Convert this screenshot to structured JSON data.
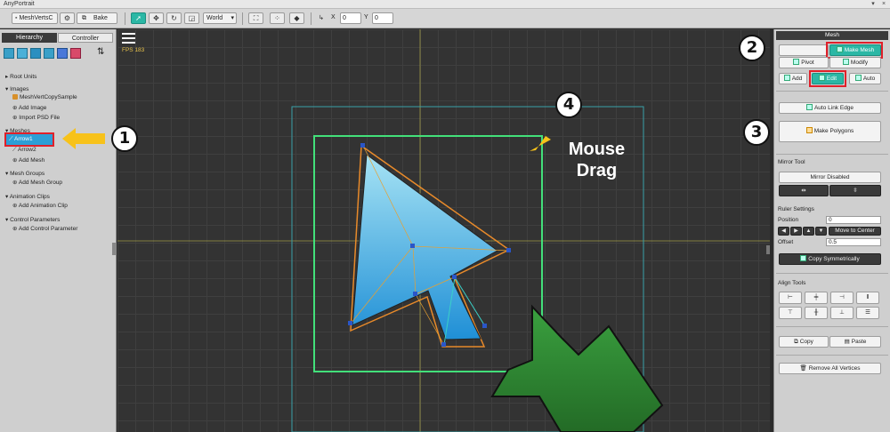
{
  "window": {
    "title": "AnyPortrait",
    "controls": [
      "▾",
      "×"
    ]
  },
  "toolbar": {
    "mesh_select": "MeshVertsC",
    "bake_label": "Bake",
    "space_select": "World",
    "x_label": "X",
    "x_value": "0",
    "y_label": "Y",
    "y_value": "0"
  },
  "left_panel": {
    "tab_hierarchy": "Hierarchy",
    "tab_controller": "Controller",
    "root_units": "Root Units",
    "images": "Images",
    "image_item": "MeshVertCopySample",
    "add_image": "Add Image",
    "import_psd": "Import PSD File",
    "meshes": "Meshes",
    "mesh_item_1": "Arrow1",
    "mesh_item_2": "Arrow2",
    "add_mesh": "Add Mesh",
    "mesh_groups": "Mesh Groups",
    "add_mesh_group": "Add Mesh Group",
    "animation_clips": "Animation Clips",
    "add_animation_clip": "Add Animation Clip",
    "control_parameters": "Control Parameters",
    "add_control_parameter": "Add Control Parameter"
  },
  "canvas": {
    "fps": "FPS 183",
    "annotation_line1": "Mouse",
    "annotation_line2": "Drag"
  },
  "right_panel": {
    "header": "Mesh",
    "make_mesh": "Make Mesh",
    "pivot": "Pivot",
    "modify": "Modify",
    "add": "Add",
    "edit": "Edit",
    "auto": "Auto",
    "auto_link_edge": "Auto Link Edge",
    "make_polygons": "Make Polygons",
    "mirror_tool": "Mirror Tool",
    "mirror_disabled": "Mirror Disabled",
    "ruler_settings": "Ruler Settings",
    "position_label": "Position",
    "position_value": "0",
    "move_to_center": "Move to Center",
    "offset_label": "Offset",
    "offset_value": "0.5",
    "copy_symmetrically": "Copy Symmetrically",
    "align_tools": "Align Tools",
    "copy": "Copy",
    "paste": "Paste",
    "remove_all_vertices": "Remove All Vertices"
  },
  "callouts": [
    "1",
    "2",
    "3",
    "4"
  ],
  "colors": {
    "accent": "#2bb7a5",
    "highlight_red": "#e0202a",
    "arrow_yellow": "#f7c21a",
    "mesh_outline": "#e88a2a",
    "selection_green": "#42e07a",
    "drag_cursor_green": "#2f8a33"
  }
}
